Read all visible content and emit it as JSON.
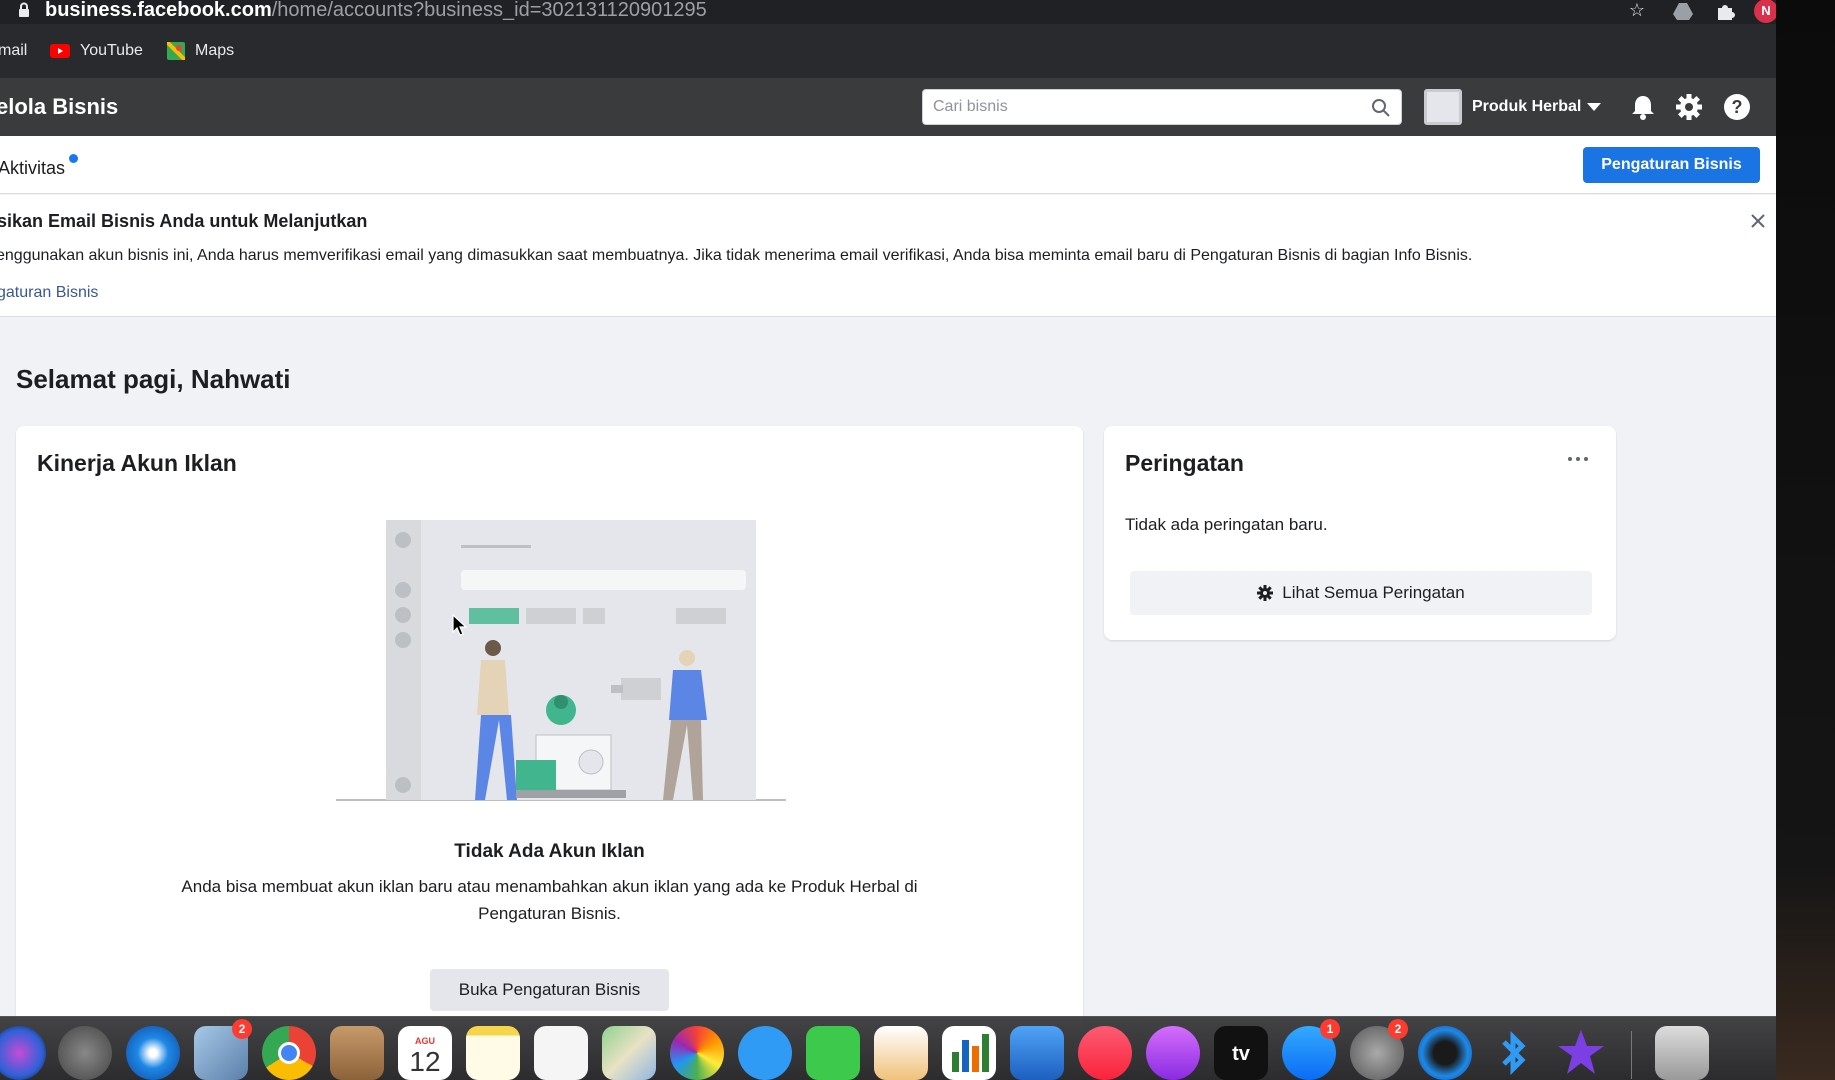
{
  "browser": {
    "url_host": "business.facebook.com",
    "url_path": "/home/accounts?business_id=302131120901295",
    "profile_initial": "N"
  },
  "bookmarks": [
    {
      "label": "mail",
      "icon": "gmail-icon"
    },
    {
      "label": "YouTube",
      "icon": "youtube-icon"
    },
    {
      "label": "Maps",
      "icon": "maps-icon"
    }
  ],
  "header": {
    "title": "elola Bisnis",
    "search_placeholder": "Cari bisnis",
    "business_name": "Produk Herbal"
  },
  "subnav": {
    "activity_label": "Aktivitas",
    "settings_button": "Pengaturan Bisnis"
  },
  "banner": {
    "title": "sikan Email Bisnis Anda untuk Melanjutkan",
    "body": "enggunakan akun bisnis ini, Anda harus memverifikasi email yang dimasukkan saat membuatnya. Jika tidak menerima email verifikasi, Anda bisa meminta email baru di Pengaturan Bisnis di bagian Info Bisnis.",
    "link": "gaturan Bisnis"
  },
  "greeting": "Selamat pagi, Nahwati",
  "ads_card": {
    "title": "Kinerja Akun Iklan",
    "empty_title": "Tidak Ada Akun Iklan",
    "empty_desc": "Anda bisa membuat akun iklan baru atau menambahkan akun iklan yang ada ke Produk Herbal di Pengaturan Bisnis.",
    "button": "Buka Pengaturan Bisnis"
  },
  "alerts_card": {
    "title": "Peringatan",
    "empty_text": "Tidak ada peringatan baru.",
    "button": "Lihat Semua Peringatan"
  },
  "dock": {
    "calendar_month": "AGU",
    "calendar_day": "12",
    "tv_label": "tv",
    "badges": [
      "2",
      "1",
      "2"
    ],
    "icons": [
      "siri-icon",
      "launchpad-icon",
      "safari-icon",
      "mail-app-icon",
      "chrome-icon",
      "contacts-icon",
      "calendar-icon",
      "notes-icon",
      "reminders-icon",
      "maps-app-icon",
      "photos-icon",
      "messages-icon",
      "facetime-icon",
      "pages-icon",
      "numbers-icon",
      "keynote-icon",
      "music-icon",
      "podcasts-icon",
      "apple-tv-icon",
      "app-store-icon",
      "system-preferences-icon",
      "edge-icon",
      "bluetooth-icon",
      "imovie-icon",
      "trash-icon"
    ]
  }
}
